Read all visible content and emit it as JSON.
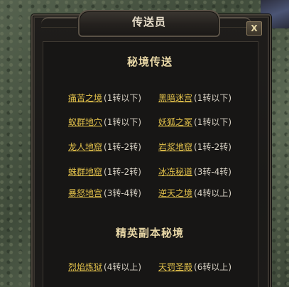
{
  "window": {
    "title": "传送员",
    "close_label": "X"
  },
  "sections": [
    {
      "title": "秘境传送",
      "entries": [
        {
          "name": "痛苦之境",
          "req": "(1转以下)"
        },
        {
          "name": "黑暗迷宫",
          "req": "(1转以下)"
        },
        {
          "name": "蚁群地穴",
          "req": "(1转以下)"
        },
        {
          "name": "妖狐之冢",
          "req": "(1转以下)"
        },
        {
          "name": "龙人地窟",
          "req": "(1转-2转)"
        },
        {
          "name": "岩浆地窟",
          "req": "(1转-2转)"
        },
        {
          "name": "蛛群地窟",
          "req": "(1转-2转)"
        },
        {
          "name": "冰冻秘道",
          "req": "(3转-4转)"
        },
        {
          "name": "暴怒地宫",
          "req": "(3转-4转)"
        },
        {
          "name": "逆天之境",
          "req": "(4转以上)"
        }
      ]
    },
    {
      "title": "精英副本秘境",
      "entries": [
        {
          "name": "烈焰炼狱",
          "req": "(4转以上)"
        },
        {
          "name": "天罚圣殿",
          "req": "(6转以上)"
        }
      ]
    }
  ],
  "colors": {
    "link": "#e2c14b",
    "section_title": "#e7d6a5",
    "panel_bg": "#1a1918"
  }
}
